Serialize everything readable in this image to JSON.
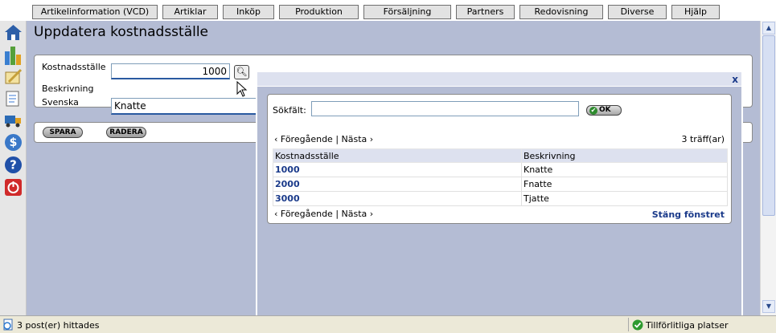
{
  "menu": {
    "tabs": [
      "Artikelinformation (VCD)",
      "Artiklar",
      "Inköp",
      "Produktion",
      "Försäljning",
      "Partners",
      "Redovisning",
      "Diverse",
      "Hjälp"
    ]
  },
  "rail": {
    "icons": [
      "home-icon",
      "chart-icon",
      "notepad-icon",
      "document-icon",
      "truck-icon",
      "dollar-icon",
      "help-icon",
      "power-icon"
    ],
    "colors": [
      "#2d5fa8",
      "#3a7fd0",
      "#c6a03a",
      "#3b7bd6",
      "#2b6bb5",
      "#3a78c8",
      "#2050a8",
      "#d02a2a"
    ]
  },
  "page": {
    "title": "Uppdatera kostnadsställe"
  },
  "form": {
    "cost_center_label": "Kostnadsställe",
    "cost_center_value": "1000",
    "description_label": "Beskrivning",
    "swedish_label": "Svenska",
    "swedish_value": "Knatte"
  },
  "actions": {
    "save_label": "SPARA",
    "delete_label": "RADERA"
  },
  "popup": {
    "close_x": "x",
    "search_label": "Sökfält:",
    "search_value": "",
    "ok_label": "OK",
    "pager_prev": "‹ Föregående",
    "pager_sep": "|",
    "pager_next": "Nästa ›",
    "hits": "3 träff(ar)",
    "columns": [
      "Kostnadsställe",
      "Beskrivning"
    ],
    "rows": [
      {
        "code": "1000",
        "description": "Knatte"
      },
      {
        "code": "2000",
        "description": "Fnatte"
      },
      {
        "code": "3000",
        "description": "Tjatte"
      }
    ],
    "close_window": "Stäng fönstret"
  },
  "status": {
    "message": "3 post(er) hittades",
    "zone": "Tillförlitliga platser"
  },
  "colors": {
    "background": "#b4bcd4",
    "link": "#1a3a8a",
    "header_row": "#dde1ef"
  }
}
